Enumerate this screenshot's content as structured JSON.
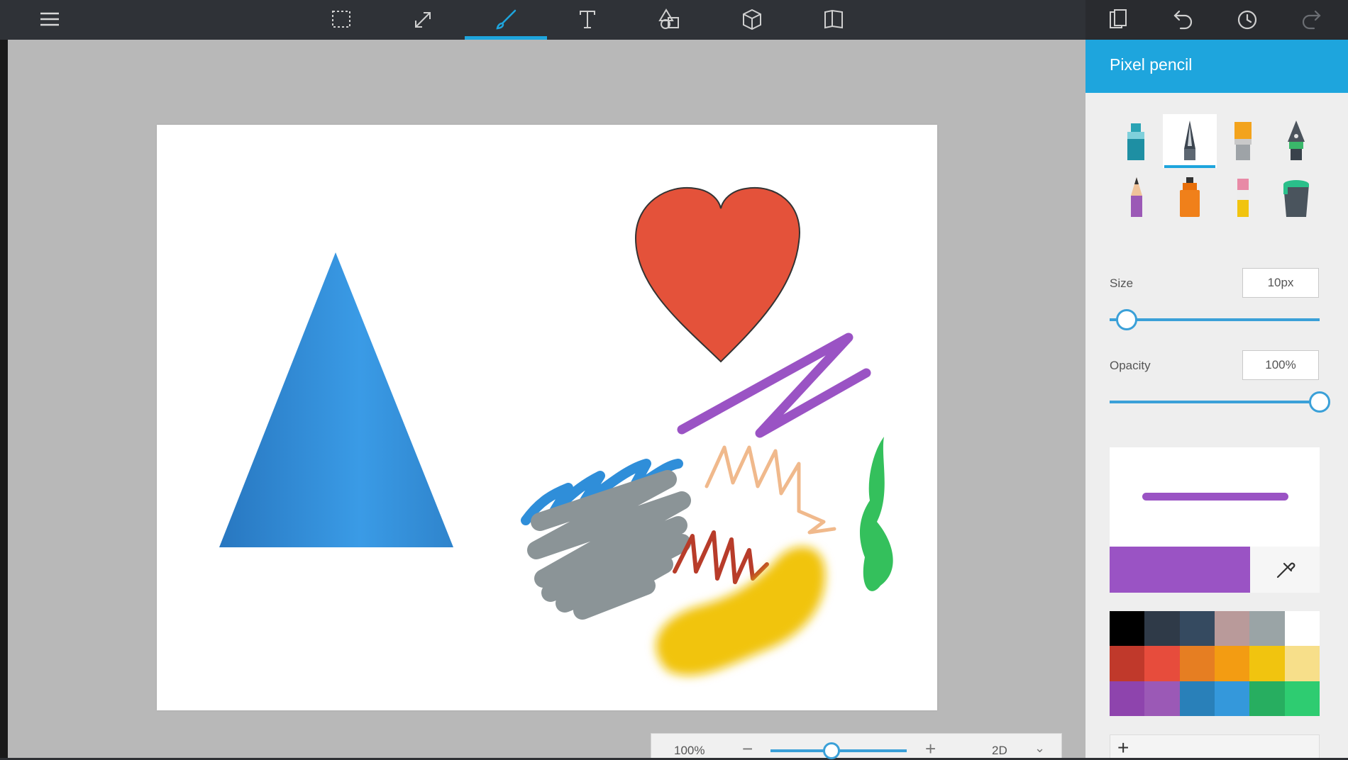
{
  "toolbar": {
    "left": [
      {
        "name": "menu-icon"
      },
      {
        "name": "select-icon"
      },
      {
        "name": "crop-resize-icon"
      },
      {
        "name": "brushes-icon",
        "active": true
      },
      {
        "name": "text-icon"
      },
      {
        "name": "2d-shapes-icon"
      },
      {
        "name": "3d-objects-icon"
      },
      {
        "name": "stickers-icon"
      }
    ],
    "right": [
      {
        "name": "paste-icon"
      },
      {
        "name": "undo-icon"
      },
      {
        "name": "history-icon"
      },
      {
        "name": "redo-icon",
        "disabled": true
      }
    ]
  },
  "panel": {
    "title": "Pixel pencil",
    "brushes": [
      {
        "name": "marker-brush-icon"
      },
      {
        "name": "pixel-pencil-brush-icon",
        "selected": true
      },
      {
        "name": "oil-brush-icon"
      },
      {
        "name": "calligraphy-pen-brush-icon"
      },
      {
        "name": "pencil-brush-icon"
      },
      {
        "name": "spray-can-brush-icon"
      },
      {
        "name": "eraser-brush-icon"
      },
      {
        "name": "fill-bucket-brush-icon"
      }
    ],
    "size": {
      "label": "Size",
      "value": "10px",
      "fraction": 0.08
    },
    "opacity": {
      "label": "Opacity",
      "value": "100%",
      "fraction": 1.0
    },
    "current_color": "#9a53c4",
    "swatches": [
      "#000000",
      "#2f3a48",
      "#354a60",
      "#b99a9a",
      "#9aa4a6",
      "#ffffff",
      "#c0392b",
      "#e74c3c",
      "#e67e22",
      "#f39c12",
      "#f1c40f",
      "#f7df8a",
      "#8e44ad",
      "#9b59b6",
      "#2980b9",
      "#3498db",
      "#27ae60",
      "#2ecc71"
    ],
    "add_color_label": "+"
  },
  "zoom": {
    "value": "100%",
    "minus": "−",
    "plus": "+",
    "mode": "2D",
    "chevron": "⌄",
    "fraction": 0.45
  },
  "canvas": {
    "colors": {
      "triangle": "#3a92d8",
      "heart": "#e4523a",
      "purple": "#9a53c4",
      "blue_scribble": "#2f8ed9",
      "gray_scribble": "#8b9497",
      "peach_scribble": "#f0b98c",
      "red_scribble": "#b83c2a",
      "green_blob": "#34c05c",
      "yellow_blob": "#f1c40f"
    }
  }
}
